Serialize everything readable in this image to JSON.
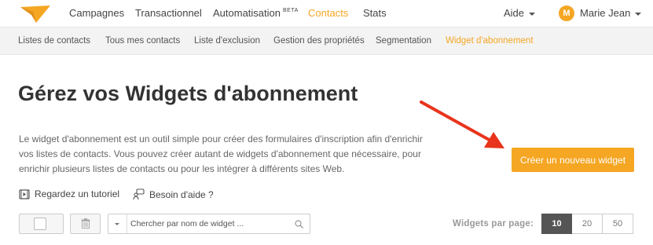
{
  "colors": {
    "accent": "#f5a623",
    "arrow": "#e8341c",
    "active_page_size_bg": "#555555"
  },
  "topnav": {
    "items": [
      {
        "label": "Campagnes",
        "badge": ""
      },
      {
        "label": "Transactionnel",
        "badge": ""
      },
      {
        "label": "Automatisation",
        "badge": "BETA"
      },
      {
        "label": "Contacts",
        "badge": "",
        "active": true
      },
      {
        "label": "Stats",
        "badge": ""
      }
    ],
    "help_label": "Aide",
    "user": {
      "initial": "M",
      "name": "Marie Jean"
    }
  },
  "subnav": {
    "items": [
      {
        "label": "Listes de contacts"
      },
      {
        "label": "Tous mes contacts"
      },
      {
        "label": "Liste d'exclusion"
      },
      {
        "label": "Gestion des propriétés"
      },
      {
        "label": "Segmentation"
      },
      {
        "label": "Widget d'abonnement",
        "active": true
      }
    ]
  },
  "main": {
    "title": "Gérez vos Widgets d'abonnement",
    "intro": "Le widget d'abonnement est un outil simple pour créer des formulaires d'inscription afin d'enrichir vos listes de contacts. Vous pouvez créer autant de widgets d'abonnement que nécessaire, pour enrichir plusieurs listes de contacts ou pour les intégrer à différents sites Web.",
    "cta_label": "Créer un nouveau widget",
    "tutorial_label": "Regardez un tutoriel",
    "help_label": "Besoin d'aide ?"
  },
  "toolbar": {
    "search_placeholder": "Chercher par nom de widget ...",
    "per_page_label": "Widgets par page:",
    "per_page_options": [
      "10",
      "20",
      "50"
    ],
    "per_page_selected": "10"
  },
  "icons": [
    "logo-icon",
    "caret-down-icon",
    "video-icon",
    "support-icon",
    "trash-icon",
    "search-icon",
    "arrow-annotation-icon"
  ]
}
